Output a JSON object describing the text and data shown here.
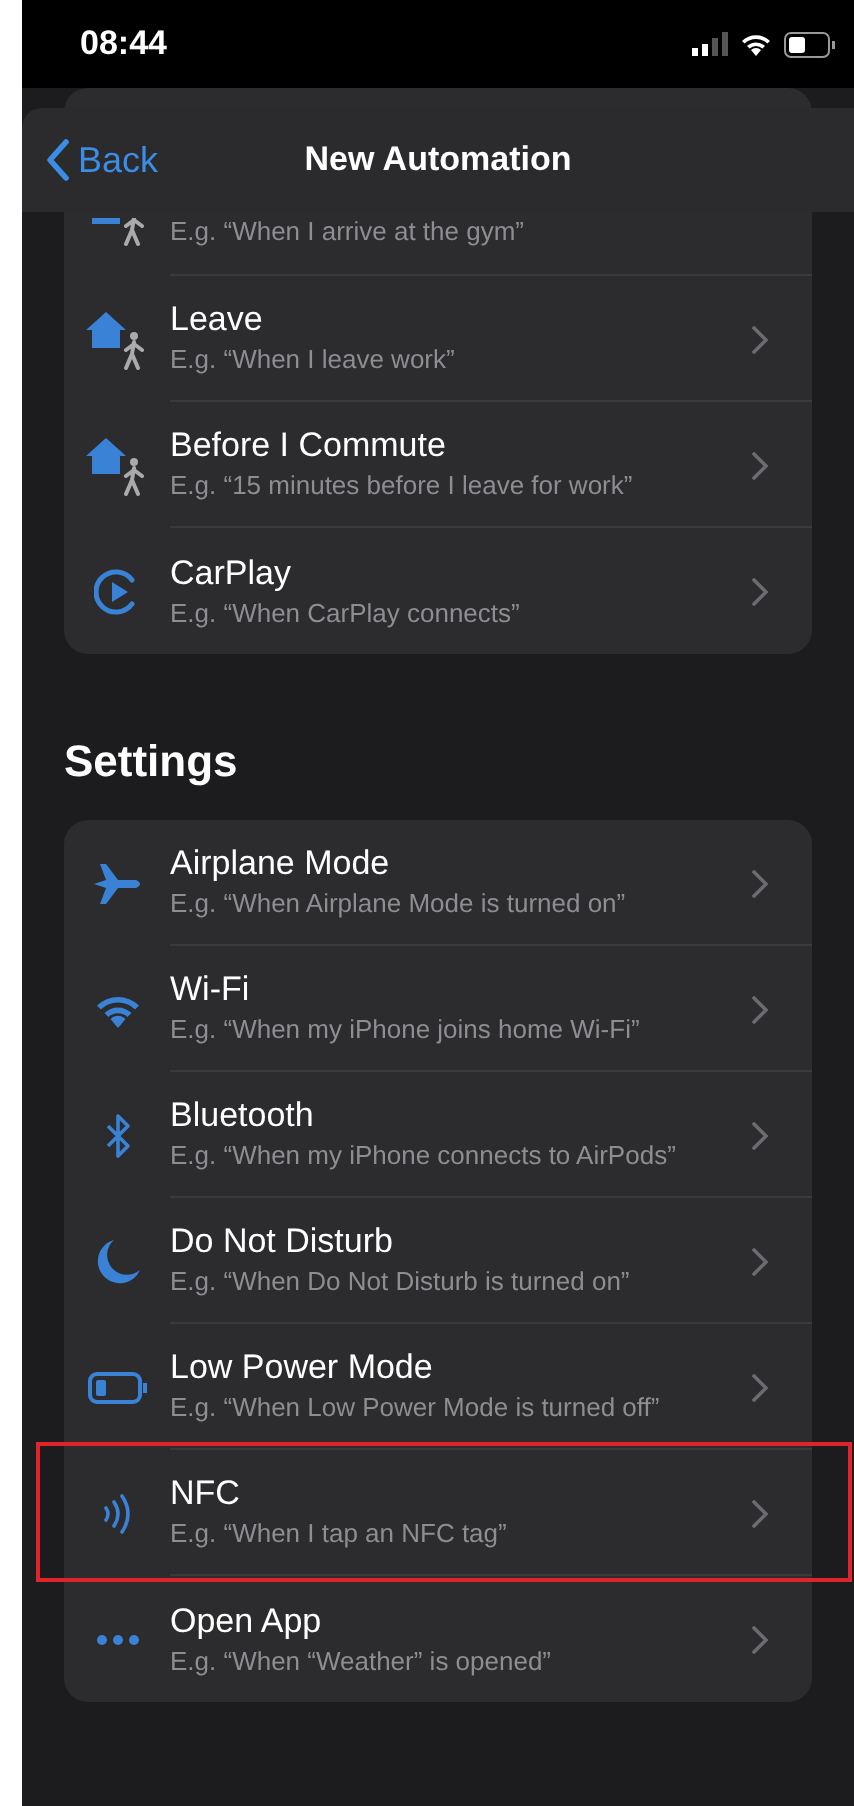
{
  "status_bar": {
    "time": "08:44"
  },
  "nav_bar": {
    "back": "Back",
    "title": "New Automation"
  },
  "sections": [
    {
      "items": [
        {
          "kind": "location",
          "subtitle": "E.g. “When I arrive at the gym”"
        },
        {
          "kind": "location",
          "title": "Leave",
          "subtitle": "E.g. “When I leave work”"
        },
        {
          "kind": "location",
          "title": "Before I Commute",
          "subtitle": "E.g. “15 minutes before I leave for work”"
        },
        {
          "kind": "carplay",
          "title": "CarPlay",
          "subtitle": "E.g. “When CarPlay connects”"
        }
      ]
    },
    {
      "header": "Settings",
      "items": [
        {
          "kind": "airplane",
          "title": "Airplane Mode",
          "subtitle": "E.g. “When Airplane Mode is turned on”"
        },
        {
          "kind": "wifi",
          "title": "Wi-Fi",
          "subtitle": "E.g. “When my iPhone joins home Wi-Fi”"
        },
        {
          "kind": "bluetooth",
          "title": "Bluetooth",
          "subtitle": "E.g. “When my iPhone connects to AirPods”"
        },
        {
          "kind": "moon",
          "title": "Do Not Disturb",
          "subtitle": "E.g. “When Do Not Disturb is turned on”"
        },
        {
          "kind": "battery",
          "title": "Low Power Mode",
          "subtitle": "E.g. “When Low Power Mode is turned off”"
        },
        {
          "kind": "nfc",
          "title": "NFC",
          "subtitle": "E.g. “When I tap an NFC tag”",
          "highlighted": true
        },
        {
          "kind": "more",
          "title": "Open App",
          "subtitle": "E.g. “When “Weather” is opened”"
        }
      ]
    }
  ]
}
